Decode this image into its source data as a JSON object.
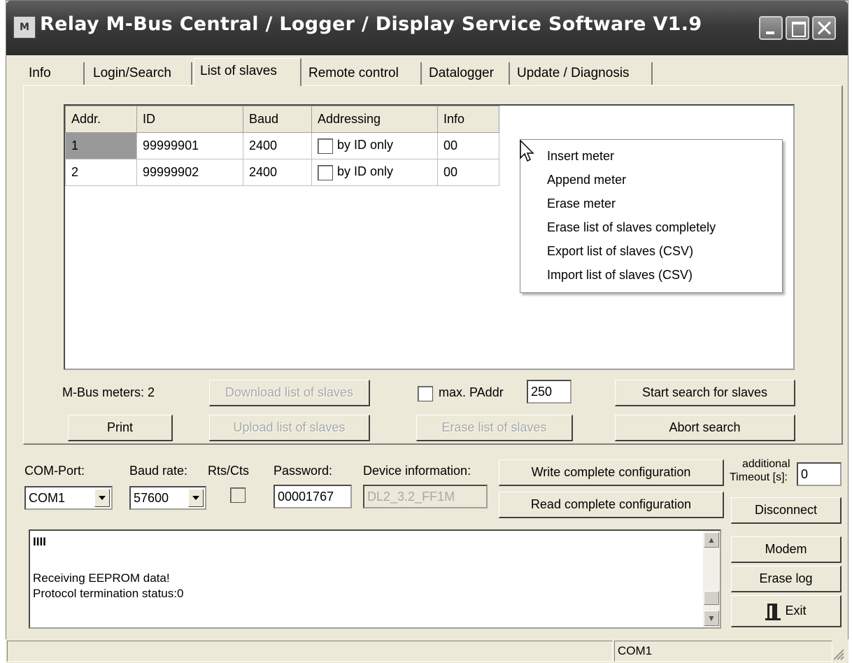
{
  "window": {
    "title": "Relay M-Bus Central / Logger / Display Service Software  V1.9",
    "icon_text": "M"
  },
  "tabs": [
    "Info",
    "Login/Search",
    "List of slaves",
    "Remote control",
    "Datalogger",
    "Update / Diagnosis"
  ],
  "active_tab": "List of slaves",
  "slaves_table": {
    "columns": [
      "Addr.",
      "ID",
      "Baud",
      "Addressing",
      "Info"
    ],
    "rows": [
      {
        "addr": "1",
        "id": "99999901",
        "baud": "2400",
        "addressing": "by ID only",
        "addressing_checked": false,
        "info": "00"
      },
      {
        "addr": "2",
        "id": "99999902",
        "baud": "2400",
        "addressing": "by ID only",
        "addressing_checked": false,
        "info": "00"
      }
    ]
  },
  "context_menu": [
    "Insert meter",
    "Append meter",
    "Erase meter",
    "Erase list of slaves completely",
    "Export list of slaves (CSV)",
    "Import list of slaves (CSV)"
  ],
  "meters": {
    "label": "M-Bus meters:",
    "count": "2"
  },
  "buttons": {
    "download": "Download list of slaves",
    "upload": "Upload list of slaves",
    "erase_list": "Erase list of slaves",
    "print": "Print",
    "start_search": "Start search for slaves",
    "abort_search": "Abort search",
    "write_config": "Write complete configuration",
    "read_config": "Read complete configuration",
    "disconnect": "Disconnect",
    "modem": "Modem",
    "erase_log": "Erase log",
    "exit": "Exit"
  },
  "max_paddr": {
    "label": "max. PAddr",
    "value": "250",
    "checked": false
  },
  "connection": {
    "com_port_label": "COM-Port:",
    "com_port": "COM1",
    "baud_label": "Baud rate:",
    "baud": "57600",
    "rts_label": "Rts/Cts",
    "rts_checked": false,
    "password_label": "Password:",
    "password": "00001767",
    "device_info_label": "Device information:",
    "device_info": "DL2_3.2_FF1M",
    "timeout_label_1": "additional",
    "timeout_label_2": "Timeout [s]:",
    "timeout": "0"
  },
  "log": {
    "progress": "IIII",
    "lines": [
      "Receiving EEPROM data!",
      "Protocol termination status:0"
    ]
  },
  "statusbar": {
    "port": "COM1"
  }
}
